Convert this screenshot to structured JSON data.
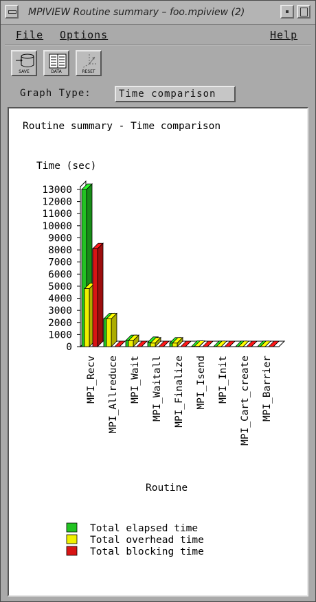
{
  "window": {
    "title": "MPIVIEW Routine summary – foo.mpiview (2)"
  },
  "menubar": {
    "file": "File",
    "options": "Options",
    "help": "Help"
  },
  "toolbar": {
    "save_label": "SAVE",
    "data_label": "DATA",
    "reset_label": "RESET"
  },
  "graph_type": {
    "label": "Graph Type:",
    "value": "Time comparison"
  },
  "chart_data": {
    "type": "bar",
    "title": "Routine summary - Time comparison",
    "ylabel": "Time (sec)",
    "xlabel": "Routine",
    "ylim": [
      0,
      13000
    ],
    "yticks": [
      0,
      1000,
      2000,
      3000,
      4000,
      5000,
      6000,
      7000,
      8000,
      9000,
      10000,
      11000,
      12000,
      13000
    ],
    "categories": [
      "MPI_Recv",
      "MPI_Allreduce",
      "MPI_Wait",
      "MPI_Waitall",
      "MPI_Finalize",
      "MPI_Isend",
      "MPI_Init",
      "MPI_Cart_create",
      "MPI_Barrier"
    ],
    "series": [
      {
        "name": "Total elapsed time",
        "color": "#22c322",
        "values": [
          13000,
          2300,
          500,
          350,
          300,
          30,
          10,
          10,
          10
        ]
      },
      {
        "name": "Total overhead time",
        "color": "#f0f000",
        "values": [
          4800,
          2300,
          500,
          300,
          300,
          20,
          5,
          5,
          5
        ]
      },
      {
        "name": "Total blocking time",
        "color": "#d81414",
        "values": [
          8100,
          0,
          0,
          0,
          0,
          0,
          0,
          0,
          0
        ]
      }
    ],
    "legend_position": "bottom-left",
    "grid": false
  }
}
